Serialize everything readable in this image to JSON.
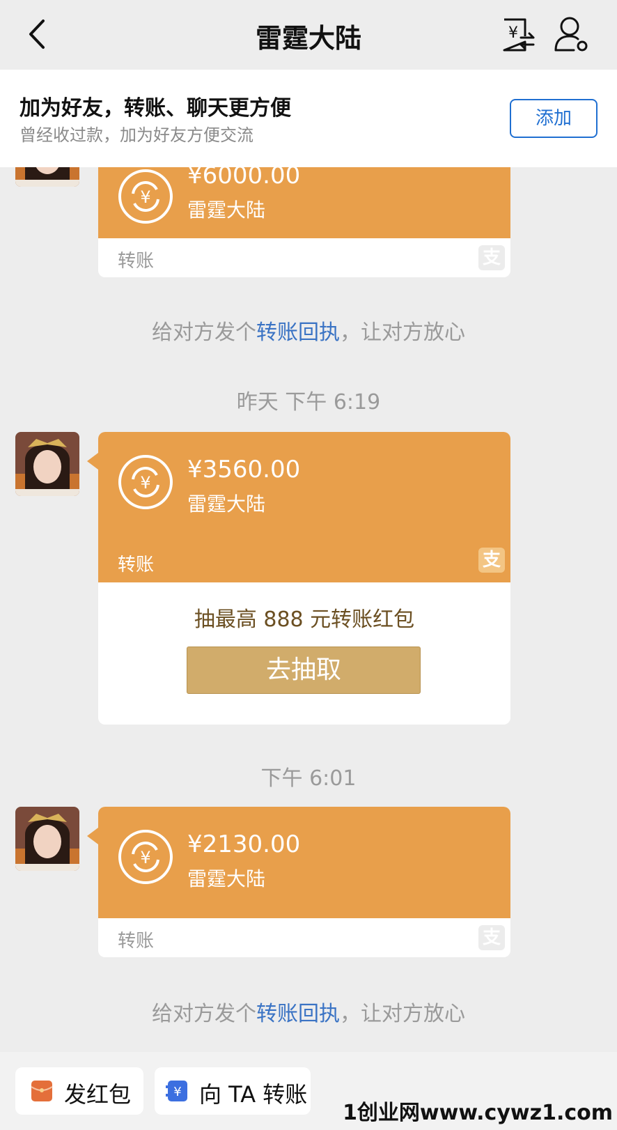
{
  "header": {
    "title": "雷霆大陆"
  },
  "banner": {
    "title": "加为好友，转账、聊天更方便",
    "subtitle": "曾经收过款，加为好友方便交流",
    "add_button": "添加"
  },
  "messages": [
    {
      "amount": "¥6000.00",
      "payee": "雷霆大陆",
      "footer_label": "转账"
    },
    {
      "amount": "¥3560.00",
      "payee": "雷霆大陆",
      "footer_label": "转账",
      "promo_text": "抽最高 888 元转账红包",
      "promo_button": "去抽取"
    },
    {
      "amount": "¥2130.00",
      "payee": "雷霆大陆",
      "footer_label": "转账"
    }
  ],
  "receipt_notice": {
    "prefix": "给对方发个",
    "link": "转账回执",
    "suffix": "，让对方放心"
  },
  "timestamps": [
    "昨天 下午 6:19",
    "下午 6:01"
  ],
  "bottom_bar": {
    "red_packet": "发红包",
    "transfer": "向 TA 转账"
  },
  "watermark": "1创业网www.cywz1.com",
  "colors": {
    "bubble": "#e89f4b",
    "link": "#3a73c4",
    "promo_button": "#d1ac6b",
    "add_button": "#1f6fd1"
  },
  "icons": [
    "back-icon",
    "bill-transfer-icon",
    "user-settings-icon",
    "transfer-circle-icon",
    "alipay-icon",
    "red-packet-icon",
    "yuan-transfer-icon"
  ]
}
